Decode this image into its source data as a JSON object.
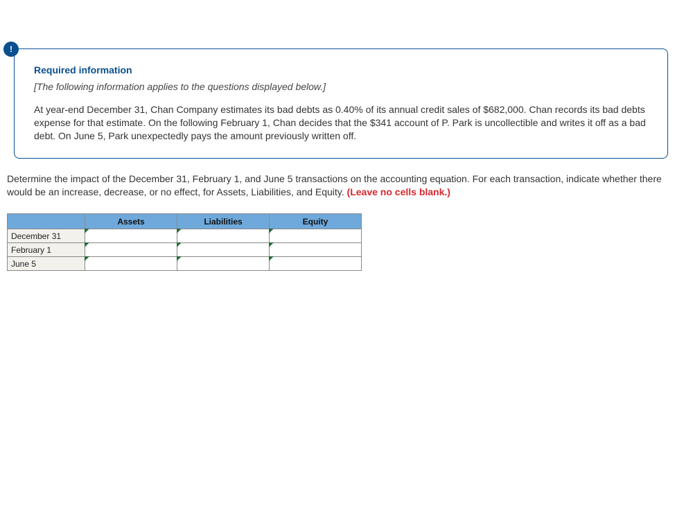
{
  "info": {
    "badge": "!",
    "heading": "Required information",
    "subtitle": "[The following information applies to the questions displayed below.]",
    "body": "At year-end December 31, Chan Company estimates its bad debts as 0.40% of its annual credit sales of $682,000. Chan records its bad debts expense for that estimate. On the following February 1, Chan decides that the $341 account of P. Park is uncollectible and writes it off as a bad debt. On June 5, Park unexpectedly pays the amount previously written off."
  },
  "question": {
    "text": "Determine the impact of the December 31, February 1, and June 5 transactions on the accounting equation. For each transaction, indicate whether there would be an increase, decrease, or no effect, for Assets, Liabilities, and Equity. ",
    "emphasis": "(Leave no cells blank.)"
  },
  "table": {
    "columns": [
      "Assets",
      "Liabilities",
      "Equity"
    ],
    "rows": [
      "December 31",
      "February 1",
      "June 5"
    ]
  }
}
